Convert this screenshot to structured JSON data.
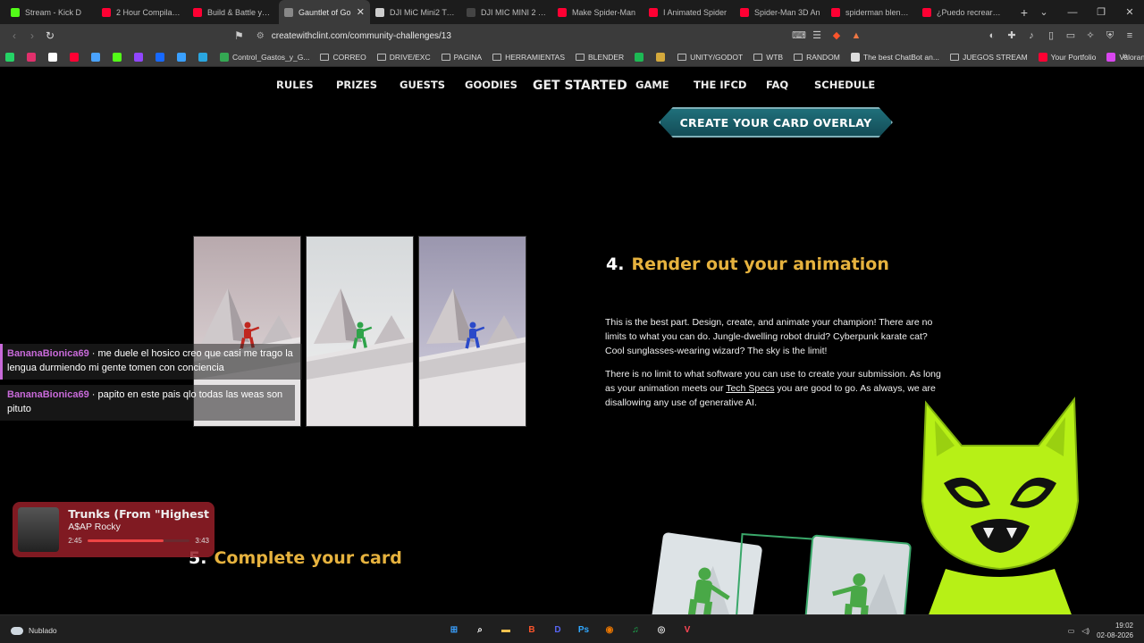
{
  "browser": {
    "tabs": [
      {
        "title": "Stream - Kick D",
        "color": "#53fc18",
        "active": false
      },
      {
        "title": "2 Hour Compilation",
        "color": "#ff0033",
        "active": false
      },
      {
        "title": "Build & Battle your",
        "color": "#ff0033",
        "active": false
      },
      {
        "title": "Gauntlet of Go",
        "color": "#888888",
        "active": true
      },
      {
        "title": "DJI MiC Mini2 Tran",
        "color": "#cccccc",
        "active": false
      },
      {
        "title": "DJI MIC MINI 2 TR",
        "color": "#444444",
        "active": false
      },
      {
        "title": "Make Spider-Man",
        "color": "#ff0033",
        "active": false
      },
      {
        "title": "I Animated Spider",
        "color": "#ff0033",
        "active": false
      },
      {
        "title": "Spider-Man 3D An",
        "color": "#ff0033",
        "active": false
      },
      {
        "title": "spiderman blender",
        "color": "#ff0033",
        "active": false
      },
      {
        "title": "¿Puedo recrear Spi",
        "color": "#ff0033",
        "active": false
      }
    ],
    "new_tab": "+",
    "url": "createwithclint.com/community-challenges/13",
    "bookmarks": [
      {
        "label": "",
        "kind": "whatsapp",
        "color": "#25d366"
      },
      {
        "label": "",
        "kind": "instagram",
        "color": "#e1306c"
      },
      {
        "label": "",
        "kind": "x",
        "color": "#ffffff"
      },
      {
        "label": "",
        "kind": "youtube",
        "color": "#ff0033"
      },
      {
        "label": "",
        "kind": "cloud",
        "color": "#4aa3ff"
      },
      {
        "label": "",
        "kind": "kick",
        "color": "#53fc18"
      },
      {
        "label": "",
        "kind": "twitch",
        "color": "#9146ff"
      },
      {
        "label": "",
        "kind": "behance",
        "color": "#1769ff"
      },
      {
        "label": "",
        "kind": "sheet",
        "color": "#3aa0ff"
      },
      {
        "label": "",
        "kind": "telegram",
        "color": "#2aa6e0"
      },
      {
        "label": "Control_Gastos_y_G...",
        "kind": "site",
        "color": "#34a853"
      },
      {
        "label": "CORREO",
        "kind": "folder"
      },
      {
        "label": "DRIVE/EXC",
        "kind": "folder"
      },
      {
        "label": "PAGINA",
        "kind": "folder"
      },
      {
        "label": "HERRAMIENTAS",
        "kind": "folder"
      },
      {
        "label": "BLENDER",
        "kind": "folder"
      },
      {
        "label": "",
        "kind": "site",
        "color": "#1db954"
      },
      {
        "label": "",
        "kind": "site",
        "color": "#d4a93c"
      },
      {
        "label": "UNITY/GODOT",
        "kind": "folder"
      },
      {
        "label": "WTB",
        "kind": "folder"
      },
      {
        "label": "RANDOM",
        "kind": "folder"
      },
      {
        "label": "The best ChatBot an...",
        "kind": "site",
        "color": "#dddddd"
      },
      {
        "label": "JUEGOS STREAM",
        "kind": "folder"
      },
      {
        "label": "Your Portfolio",
        "kind": "site",
        "color": "#ff0033"
      },
      {
        "label": "ValorantRank.Chat",
        "kind": "site",
        "color": "#d946ef"
      }
    ]
  },
  "site": {
    "nav": [
      "RULES",
      "PRIZES",
      "GUESTS",
      "GOODIES",
      "GET STARTED",
      "GAME",
      "THE IFCD",
      "FAQ",
      "SCHEDULE"
    ],
    "cta_label": "CREATE YOUR CARD OVERLAY",
    "step4": {
      "number": "4.",
      "title": "Render out your animation",
      "p1": "This is the best part. Design, create, and animate your champion! There are no limits to what you can do. Jungle-dwelling robot druid? Cyberpunk karate cat? Cool sunglasses-wearing wizard? The sky is the limit!",
      "p2_before": "There is no limit to what software you can use to create your submission. As long as your animation meets our ",
      "p2_link": "Tech Specs",
      "p2_after": " you are good to go. As always, we are disallowing any use of generative AI."
    },
    "step5": {
      "number": "5.",
      "title": "Complete your card"
    },
    "thumbnails": [
      {
        "figure_color": "#c0271f"
      },
      {
        "figure_color": "#2fa34a"
      },
      {
        "figure_color": "#2a49c9"
      }
    ]
  },
  "overlay": {
    "chat": [
      {
        "user": "BananaBionica69",
        "sep": " · ",
        "message": "me duele el hosico creo que casi me trago la lengua durmiendo mi gente tomen con conciencia"
      },
      {
        "user": "BananaBionica69",
        "sep": " · ",
        "message": "papito en este pais qlo todas las weas son pituto"
      }
    ],
    "music": {
      "song": "Trunks (From \"Highest",
      "artist": "A$AP Rocky",
      "elapsed": "2:45",
      "duration": "3:43",
      "progress": 0.74
    }
  },
  "taskbar": {
    "weather": "Nublado",
    "apps": [
      {
        "name": "start",
        "glyph": "⊞",
        "color": "#3aa0ff"
      },
      {
        "name": "search",
        "glyph": "⌕",
        "color": "#ffffff"
      },
      {
        "name": "explorer",
        "glyph": "▬",
        "color": "#f2c14e"
      },
      {
        "name": "brave",
        "glyph": "B",
        "color": "#fb542b"
      },
      {
        "name": "discord",
        "glyph": "D",
        "color": "#5865f2"
      },
      {
        "name": "photoshop",
        "glyph": "Ps",
        "color": "#31a8ff"
      },
      {
        "name": "blender",
        "glyph": "◉",
        "color": "#ea7600"
      },
      {
        "name": "spotify",
        "glyph": "♫",
        "color": "#1db954"
      },
      {
        "name": "obs",
        "glyph": "◎",
        "color": "#dddddd"
      },
      {
        "name": "valorant",
        "glyph": "V",
        "color": "#ff4655"
      }
    ],
    "time": "19:02",
    "date": "02-08-2026"
  }
}
